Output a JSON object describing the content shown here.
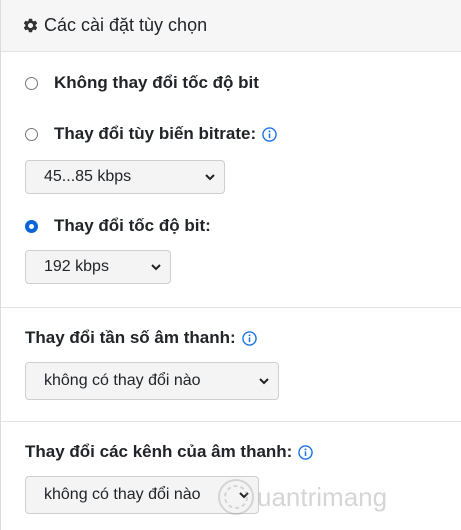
{
  "header": {
    "title": "Các cài đặt tùy chọn",
    "icon": "gear-icon"
  },
  "bitrate": {
    "options": [
      {
        "label": "Không thay đổi tốc độ bit",
        "checked": false
      },
      {
        "label": "Thay đổi tùy biến bitrate:",
        "checked": false,
        "has_info": true
      },
      {
        "label": "Thay đổi tốc độ bit:",
        "checked": true
      }
    ],
    "variable_select_value": "45...85 kbps",
    "constant_select_value": "192 kbps"
  },
  "sample_rate": {
    "label": "Thay đổi tần số âm thanh:",
    "select_value": "không có thay đổi nào"
  },
  "channels": {
    "label": "Thay đổi các kênh của âm thanh:",
    "select_value": "không có thay đổi nào"
  },
  "colors": {
    "accent": "#0a66d8",
    "info": "#1a73e8"
  },
  "watermark": {
    "text": "Quantrimang"
  }
}
